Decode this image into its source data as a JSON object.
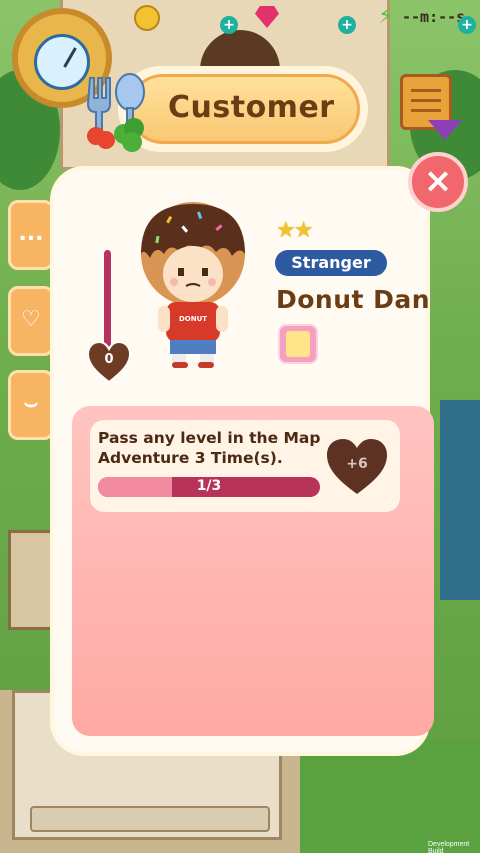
{
  "hud": {
    "timer": "--m:--s",
    "plus_label": "+",
    "energy_icon": "⚡"
  },
  "side_buttons": [
    {
      "name": "more",
      "label": "..."
    },
    {
      "name": "favorites",
      "label": "♡"
    },
    {
      "name": "wardrobe",
      "label": "⌣"
    }
  ],
  "dialog": {
    "title": "Customer",
    "close_label": "×",
    "affection_value": "0",
    "stars": "★★",
    "rank": "Stranger",
    "character_name": "Donut Dan",
    "shirt_text": "DONUT"
  },
  "task": {
    "description": "Pass any level in the Map Adventure 3 Time(s).",
    "progress_label": "1/3",
    "progress_fraction": 0.333,
    "reward_label": "+6"
  },
  "footer": {
    "dev_build": "Development Build"
  },
  "colors": {
    "title_text": "#6b3d14",
    "rank_badge": "#2d5aa0",
    "close_button": "#f0676d",
    "task_panel": "#ffb3ad",
    "progress_track": "#b8335a",
    "progress_fill": "#f28aa0"
  }
}
